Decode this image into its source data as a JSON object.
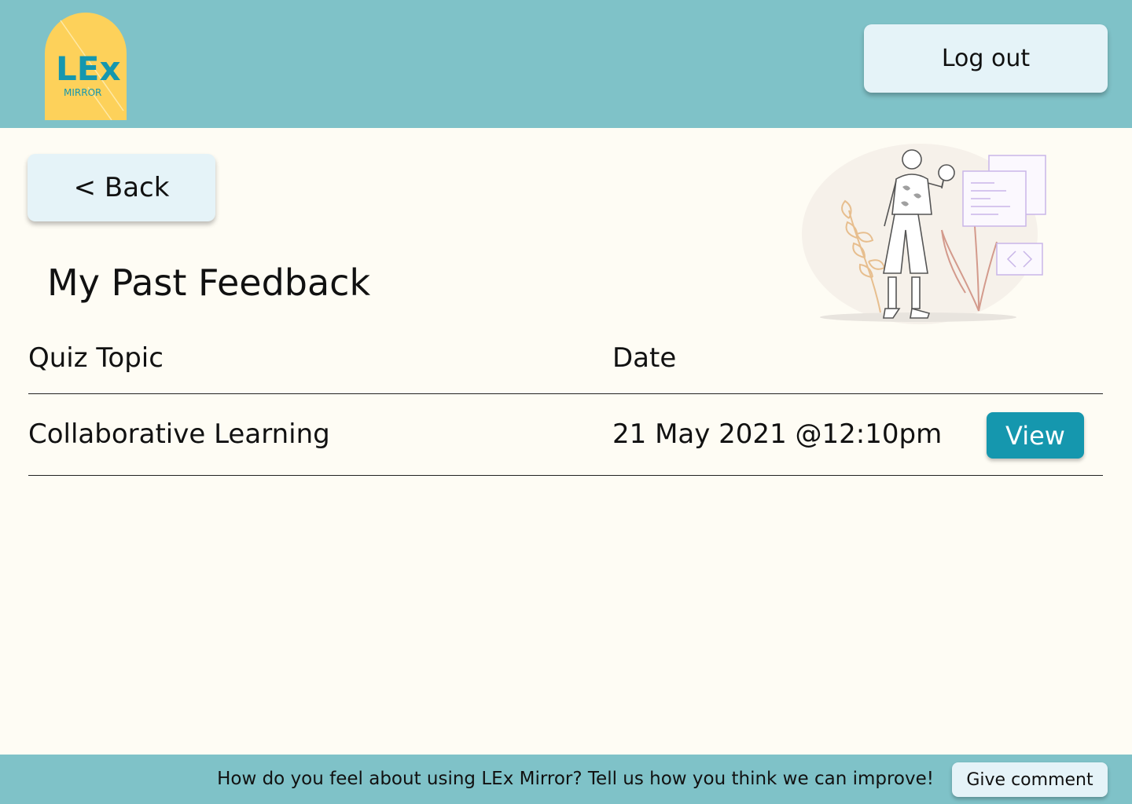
{
  "header": {
    "logo": {
      "text": "LEx",
      "subtext": "MIRROR"
    },
    "logout_label": "Log out"
  },
  "nav": {
    "back_label": "< Back"
  },
  "page": {
    "title": "My Past Feedback"
  },
  "table": {
    "columns": [
      "Quiz Topic",
      "Date"
    ],
    "rows": [
      {
        "topic": "Collaborative Learning",
        "date": "21 May 2021 @12:10pm",
        "action_label": "View"
      }
    ]
  },
  "footer": {
    "prompt": "How do you feel about using LEx Mirror? Tell us how you think we can improve!",
    "comment_label": "Give comment"
  },
  "colors": {
    "header_bg": "#7FC2C8",
    "page_bg": "#FEFCF4",
    "button_bg": "#E5F3F8",
    "primary": "#1597AE",
    "logo_bg": "#FDD15A"
  },
  "illustration": {
    "icon": "person-with-magnifier-illustration"
  }
}
